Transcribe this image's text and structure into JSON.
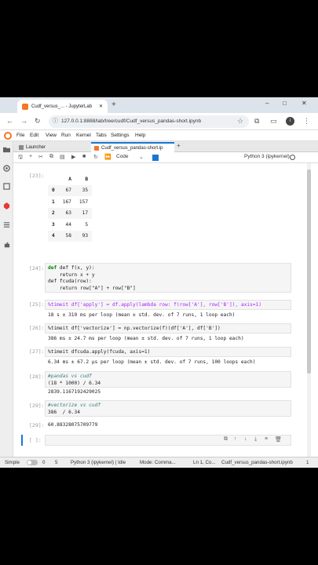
{
  "browser": {
    "tab_title": "Cudf_versus_... - JupyterLab",
    "new_tab": "+",
    "url": "127.0.0.1:8888/lab/tree/cudf/Cudf_versus_pandas-short.ipynb",
    "window_controls": [
      "–",
      "□",
      "✕"
    ],
    "avatar_letter": "i"
  },
  "menu": [
    "File",
    "Edit",
    "View",
    "Run",
    "Kernel",
    "Tabs",
    "Settings",
    "Help"
  ],
  "doc_tabs": [
    {
      "label": "Launcher"
    },
    {
      "label": "Cudf_versus_pandas-short.ip"
    }
  ],
  "toolbar": {
    "cell_type": "Code",
    "kernel": "Python 3 (ipykernel)"
  },
  "cells": {
    "c23": {
      "prompt": "[23]:",
      "code": "df.head(5)",
      "table": {
        "columns": [
          "",
          "A",
          "B"
        ],
        "rows": [
          [
            "0",
            "67",
            "35"
          ],
          [
            "1",
            "167",
            "157"
          ],
          [
            "2",
            "63",
            "17"
          ],
          [
            "3",
            "44",
            "5"
          ],
          [
            "4",
            "58",
            "93"
          ]
        ]
      }
    },
    "c24": {
      "prompt": "[24]:",
      "code_lines": [
        "def f(x, y):",
        "    return x + y",
        "def fcuda(row):",
        "    return row[\"A\"] + row[\"B\"]"
      ]
    },
    "c25": {
      "prompt": "[25]:",
      "code": "%timeit df['apply'] = df.apply(lambda row: f(row['A'], row['B']), axis=1)",
      "output": "18 s ± 319 ms per loop (mean ± std. dev. of 7 runs, 1 loop each)"
    },
    "c26": {
      "prompt": "[26]:",
      "code": "%timeit df['vectorize'] = np.vectorize(f)(df['A'], df['B'])",
      "output": "386 ms ± 24.7 ms per loop (mean ± std. dev. of 7 runs, 1 loop each)"
    },
    "c27": {
      "prompt": "[27]:",
      "code": "%timeit dfcuda.apply(fcuda, axis=1)",
      "output": "6.34 ms ± 67.2 µs per loop (mean ± std. dev. of 7 runs, 100 loops each)"
    },
    "c28": {
      "prompt": "[28]:",
      "code_lines": [
        "#pandas vs cudf",
        "(18 * 1000) / 6.34"
      ],
      "output": "2839.1167192429025"
    },
    "c29": {
      "prompt": "[29]:",
      "code_lines": [
        "#vectorize vs cudf",
        "386  / 6.34"
      ],
      "output": "60.88328075709779"
    },
    "empty": {
      "prompt": "[ ]:"
    }
  },
  "status": {
    "mode_label": "Simple",
    "counts_a": "0",
    "counts_b": "5",
    "kernel": "Python 3 (ipykernel) | Idle",
    "mode": "Mode: Comma...",
    "position": "Ln 1, Co...",
    "file": "Cudf_versus_pandas-short.ipynb",
    "notif": "1"
  }
}
